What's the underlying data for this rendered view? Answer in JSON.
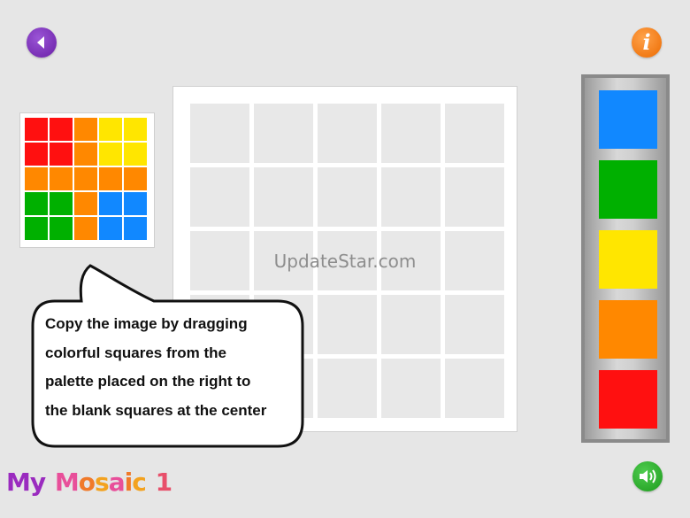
{
  "colors": {
    "red": "#ff1010",
    "orange": "#ff8800",
    "yellow": "#ffe600",
    "green": "#00b000",
    "blue": "#1188ff",
    "background": "#e6e6e6"
  },
  "header": {
    "back_icon": "back-arrow-icon",
    "info_icon": "info-icon",
    "info_label": "i"
  },
  "target_image": {
    "rows": [
      [
        "red",
        "red",
        "orange",
        "yellow",
        "yellow"
      ],
      [
        "red",
        "red",
        "orange",
        "yellow",
        "yellow"
      ],
      [
        "orange",
        "orange",
        "orange",
        "orange",
        "orange"
      ],
      [
        "green",
        "green",
        "orange",
        "blue",
        "blue"
      ],
      [
        "green",
        "green",
        "orange",
        "blue",
        "blue"
      ]
    ]
  },
  "board": {
    "rows": 5,
    "cols": 5
  },
  "watermark": "UpdateStar.com",
  "palette": {
    "swatches": [
      "blue",
      "green",
      "yellow",
      "orange",
      "red"
    ]
  },
  "instruction": {
    "lines": [
      "Copy the image by dragging",
      "colorful squares from the",
      "palette placed on the right to",
      "the blank squares at the center"
    ]
  },
  "logo": {
    "text": "My Mosaic 1",
    "letters": [
      {
        "ch": "M",
        "color": "#9a2bbf"
      },
      {
        "ch": "y",
        "color": "#9a2bbf"
      },
      {
        "ch": " ",
        "color": "#000000"
      },
      {
        "ch": "M",
        "color": "#e84f9a"
      },
      {
        "ch": "o",
        "color": "#f07a2a"
      },
      {
        "ch": "s",
        "color": "#f3a21f"
      },
      {
        "ch": "a",
        "color": "#e84f9a"
      },
      {
        "ch": "i",
        "color": "#f07a2a"
      },
      {
        "ch": "c",
        "color": "#f3a21f"
      },
      {
        "ch": " ",
        "color": "#000000"
      },
      {
        "ch": "1",
        "color": "#e84f6a"
      }
    ]
  },
  "footer": {
    "sound_icon": "speaker-icon"
  }
}
